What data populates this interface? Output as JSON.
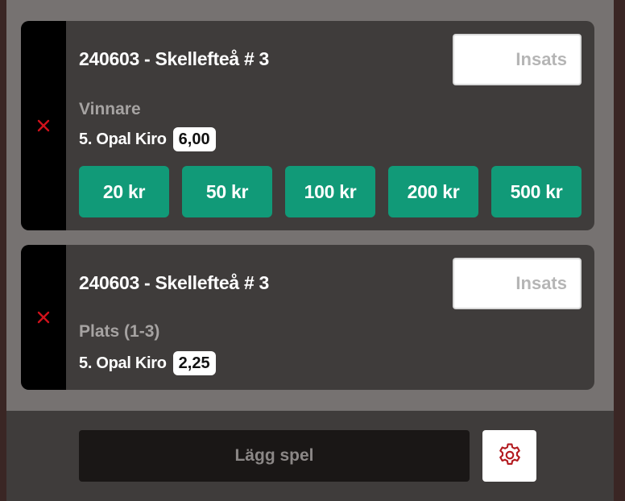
{
  "colors": {
    "accent_green": "#119a78",
    "remove_red": "#d0121b",
    "settings_red": "#b31b20"
  },
  "bets": [
    {
      "race": "240603 - Skellefteå # 3",
      "stake_placeholder": "Insats",
      "stake_value": "",
      "bet_type": "Vinnare",
      "horse": "5. Opal Kiro",
      "odds": "6,00",
      "quick_amounts": [
        "20 kr",
        "50 kr",
        "100 kr",
        "200 kr",
        "500 kr"
      ],
      "remove_icon": "close-icon"
    },
    {
      "race": "240603 - Skellefteå # 3",
      "stake_placeholder": "Insats",
      "stake_value": "",
      "bet_type": "Plats (1-3)",
      "horse": "5. Opal Kiro",
      "odds": "2,25",
      "remove_icon": "close-icon"
    }
  ],
  "footer": {
    "place_bet_label": "Lägg spel",
    "settings_icon": "gear-icon"
  }
}
